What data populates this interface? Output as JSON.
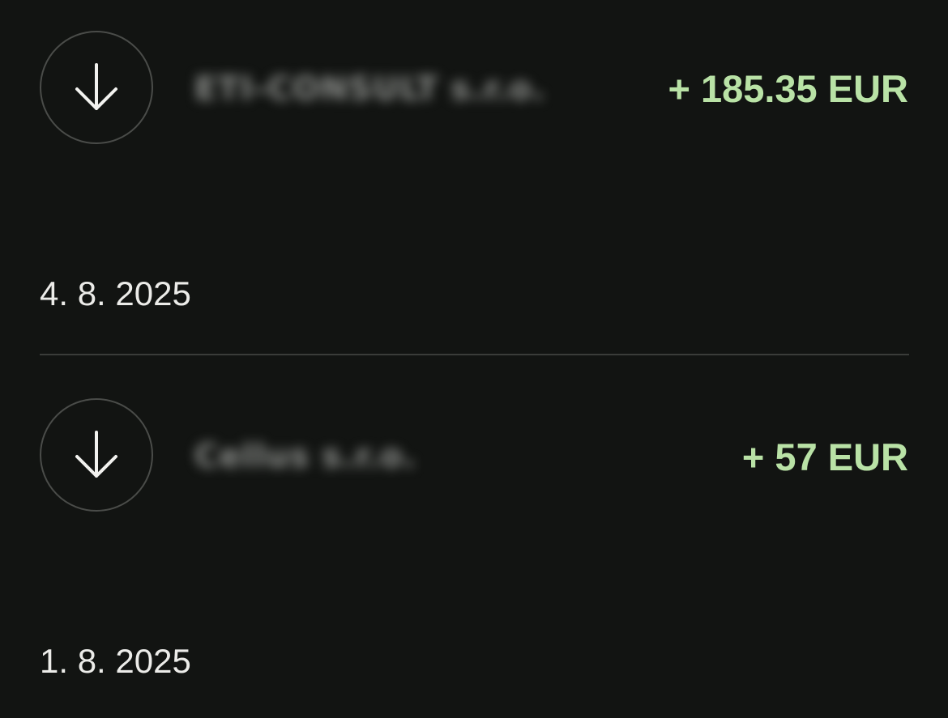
{
  "transactions": [
    {
      "direction_icon": "arrow-down-icon",
      "counterparty": "ETI-CONSULT s.r.o.",
      "amount": "+ 185.35 EUR",
      "date": "4. 8. 2025"
    },
    {
      "direction_icon": "arrow-down-icon",
      "counterparty": "Cellus s.r.o.",
      "amount": "+ 57 EUR",
      "date": "1. 8. 2025"
    }
  ],
  "colors": {
    "background": "#121412",
    "amount_positive": "#b9e2a6",
    "text": "#ecece9",
    "divider": "#3a3c39"
  }
}
